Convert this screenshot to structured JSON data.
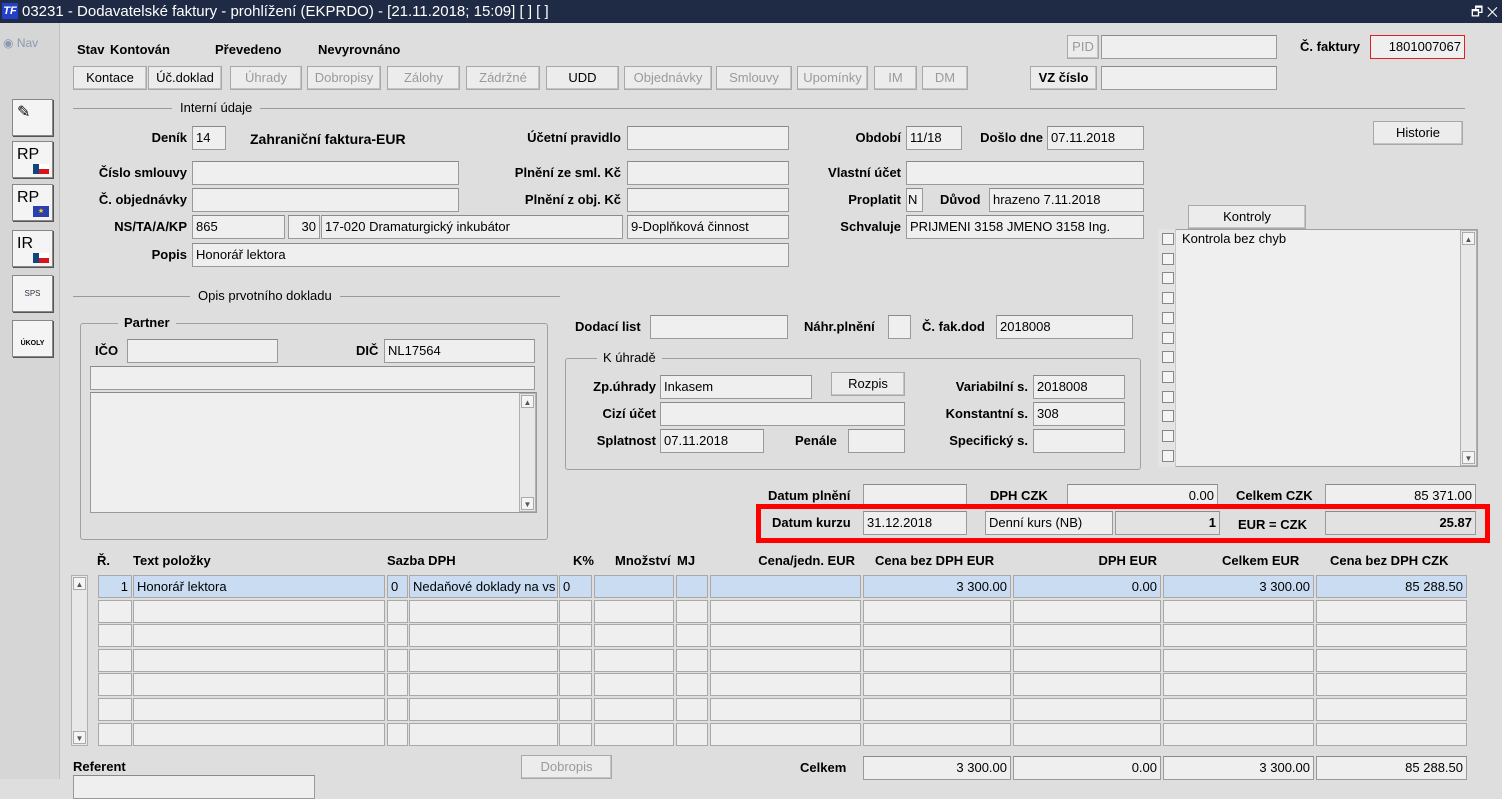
{
  "window": {
    "title": "03231 - Dodavatelské faktury - prohlížení (EKPRDO) - [21.11.2018; 15:09]  [ ]  [ ]",
    "logo": "TF",
    "controls": "🗗 ✕"
  },
  "nav": {
    "label": "Nav",
    "buttons": [
      {
        "icon": "pen-icon",
        "label": "✎"
      },
      {
        "icon": "rp-cz-flag-icon",
        "label": "RP"
      },
      {
        "icon": "rp-eu-flag-icon",
        "label": "RP"
      },
      {
        "icon": "ir-cz-flag-icon",
        "label": "IR"
      },
      {
        "icon": "sps-icon",
        "label": "SPS"
      },
      {
        "icon": "ukoly-icon",
        "label": "ÚKOLY"
      }
    ]
  },
  "status": {
    "stav_label": "Stav",
    "stav": "Kontován",
    "prevedeno": "Převedeno",
    "vyrovnani": "Nevyrovnáno"
  },
  "toolbar": [
    "Kontace",
    "Úč.doklad",
    "Úhrady",
    "Dobropisy",
    "Zálohy",
    "Zádržné",
    "UDD",
    "Objednávky",
    "Smlouvy",
    "Upomínky",
    "IM",
    "DM"
  ],
  "header": {
    "pid_label": "PID",
    "pid": "",
    "faktura_label": "Č. faktury",
    "faktura": "1801007067",
    "vz_label": "VZ číslo",
    "vz": ""
  },
  "interni": {
    "title": "Interní údaje",
    "denik_label": "Deník",
    "denik": "14",
    "denik_name": "Zahraniční faktura-EUR",
    "ucetni_pravidlo_label": "Účetní pravidlo",
    "ucetni_pravidlo": "",
    "obdobi_label": "Období",
    "obdobi": "11/18",
    "doslo_label": "Došlo dne",
    "doslo": "07.11.2018",
    "historie": "Historie",
    "smlouva_label": "Číslo smlouvy",
    "smlouva": "",
    "plneni_sml_label": "Plnění ze sml. Kč",
    "plneni_sml": "",
    "vlastni_ucet_label": "Vlastní účet",
    "vlastni_ucet": "",
    "objednavka_label": "Č. objednávky",
    "objednavka": "",
    "plneni_obj_label": "Plnění z obj. Kč",
    "plneni_obj": "",
    "proplatit_label": "Proplatit",
    "proplatit": "N",
    "duvod_label": "Důvod",
    "duvod": "hrazeno 7.11.2018",
    "ns_label": "NS/TA/A/KP",
    "ns": "865",
    "ta": "30",
    "a": "17-020 Dramaturgický inkubátor",
    "kp": "9-Doplňková činnost",
    "schvaluje_label": "Schvaluje",
    "schvaluje": "PRIJMENI 3158 JMENO 3158 Ing.",
    "popis_label": "Popis",
    "popis": "Honorář lektora"
  },
  "kontroly": {
    "button": "Kontroly",
    "items": [
      "Kontrola bez chyb",
      "",
      "",
      "",
      "",
      "",
      "",
      "",
      "",
      "",
      "",
      ""
    ]
  },
  "opis": {
    "title": "Opis prvotního dokladu",
    "partner_title": "Partner",
    "ico_label": "IČO",
    "ico": "",
    "dic_label": "DIČ",
    "dic": "NL17564",
    "name": "",
    "address": "",
    "dodaci_label": "Dodací list",
    "dodaci": "",
    "nahr_label": "Náhr.plnění",
    "nahr": "",
    "fakdod_label": "Č. fak.dod",
    "fakdod": "2018008"
  },
  "uhrada": {
    "title": "K úhradě",
    "zp_label": "Zp.úhrady",
    "zp": "Inkasem",
    "rozpis": "Rozpis",
    "var_label": "Variabilní s.",
    "var": "2018008",
    "cizi_label": "Cizí účet",
    "cizi": "",
    "konst_label": "Konstantní s.",
    "konst": "308",
    "splatnost_label": "Splatnost",
    "splatnost": "07.11.2018",
    "penale_label": "Penále",
    "penale": "",
    "spec_label": "Specifický s.",
    "spec": ""
  },
  "sumy": {
    "datum_plneni_label": "Datum plnění",
    "datum_plneni": "",
    "dph_czk_label": "DPH  CZK",
    "dph_czk": "0.00",
    "celkem_czk_label": "Celkem  CZK",
    "celkem_czk": "85 371.00",
    "datum_kurzu_label": "Datum kurzu",
    "datum_kurzu": "31.12.2018",
    "kurs_typ": "Denní kurs (NB)",
    "kurs_mnozstvi": "1",
    "kurs_label": "EUR = CZK",
    "kurs": "25.87",
    "highlight_color": "#ff0000"
  },
  "items": {
    "headers": [
      "Ř.",
      "Text položky",
      "Sazba DPH",
      "K%",
      "Množství",
      "MJ",
      "Cena/jedn.  EUR",
      "Cena bez DPH  EUR",
      "DPH  EUR",
      "Celkem  EUR",
      "Cena bez DPH  CZK"
    ],
    "rows": [
      [
        "1",
        "Honorář lektora",
        "0",
        "Nedaňové doklady na vs",
        "0",
        "",
        "",
        "",
        "3 300.00",
        "0.00",
        "3 300.00",
        "85 288.50"
      ],
      [
        "",
        "",
        "",
        "",
        "",
        "",
        "",
        "",
        "",
        "",
        "",
        ""
      ],
      [
        "",
        "",
        "",
        "",
        "",
        "",
        "",
        "",
        "",
        "",
        "",
        ""
      ],
      [
        "",
        "",
        "",
        "",
        "",
        "",
        "",
        "",
        "",
        "",
        "",
        ""
      ],
      [
        "",
        "",
        "",
        "",
        "",
        "",
        "",
        "",
        "",
        "",
        "",
        ""
      ],
      [
        "",
        "",
        "",
        "",
        "",
        "",
        "",
        "",
        "",
        "",
        "",
        ""
      ],
      [
        "",
        "",
        "",
        "",
        "",
        "",
        "",
        "",
        "",
        "",
        "",
        ""
      ]
    ]
  },
  "footer": {
    "referent_label": "Referent",
    "referent": "",
    "dobropis": "Dobropis",
    "celkem_label": "Celkem",
    "celkem_eur_bez": "3 300.00",
    "celkem_dph": "0.00",
    "celkem_eur": "3 300.00",
    "celkem_czk": "85 288.50"
  }
}
